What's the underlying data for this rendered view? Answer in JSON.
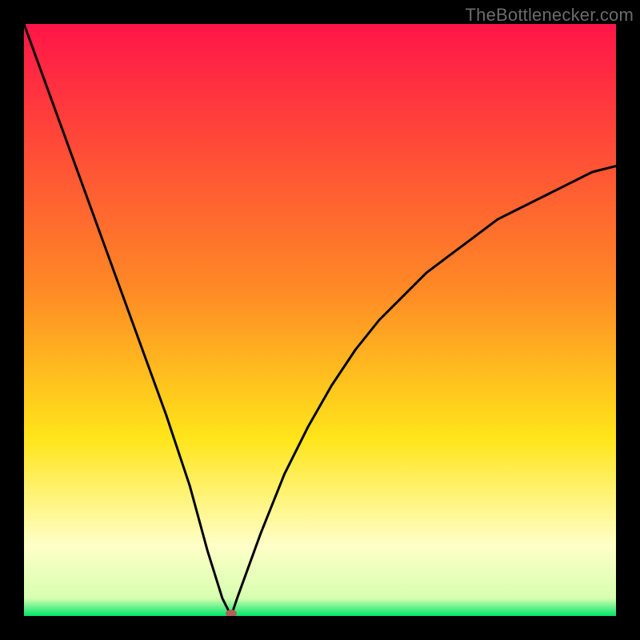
{
  "watermark": "TheBottlenecker.com",
  "colors": {
    "top": "#ff1548",
    "mid1": "#ff6e2a",
    "mid2": "#ffe51a",
    "pale": "#ffffc7",
    "base": "#00e56a",
    "frame": "#000000",
    "curve": "#000000",
    "marker": "#b16055"
  },
  "chart_data": {
    "type": "line",
    "title": "",
    "xlabel": "",
    "ylabel": "",
    "xlim": [
      0,
      100
    ],
    "ylim": [
      0,
      100
    ],
    "grid": false,
    "legend": false,
    "series": [
      {
        "name": "bottleneck-curve",
        "x": [
          0,
          4,
          8,
          12,
          16,
          20,
          24,
          28,
          31,
          33.5,
          35,
          36,
          40,
          44,
          48,
          52,
          56,
          60,
          64,
          68,
          72,
          76,
          80,
          84,
          88,
          92,
          96,
          100
        ],
        "y": [
          100,
          89,
          78,
          67,
          56,
          45,
          34,
          22,
          11,
          3,
          0,
          3,
          14,
          24,
          32,
          39,
          45,
          50,
          54,
          58,
          61,
          64,
          67,
          69,
          71,
          73,
          75,
          76
        ]
      }
    ],
    "marker": {
      "x": 35,
      "y": 0
    },
    "gradient_stops": [
      {
        "offset": 0.0,
        "color": "#ff1548"
      },
      {
        "offset": 0.45,
        "color": "#ff8a25"
      },
      {
        "offset": 0.7,
        "color": "#ffe51a"
      },
      {
        "offset": 0.88,
        "color": "#ffffc7"
      },
      {
        "offset": 0.97,
        "color": "#d7ffb0"
      },
      {
        "offset": 1.0,
        "color": "#00e56a"
      }
    ]
  }
}
